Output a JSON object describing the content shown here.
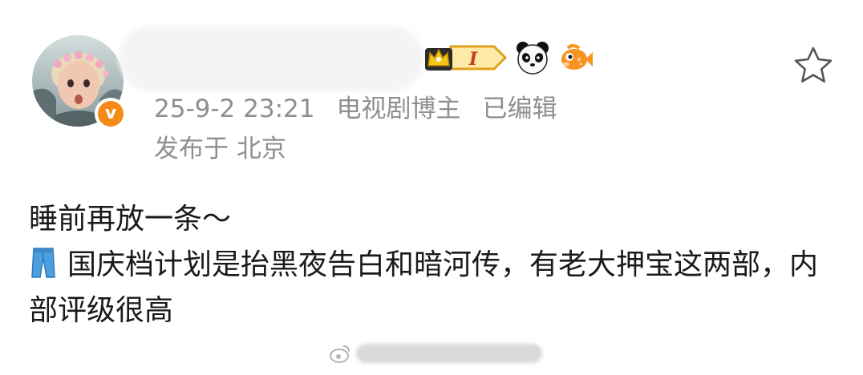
{
  "post": {
    "meta": {
      "timestamp": "25-9-2 23:21",
      "role": "电视剧博主",
      "edited": "已编辑",
      "location": "发布于 北京"
    },
    "content": {
      "line1": "睡前再放一条～",
      "line2": "国庆档计划是抬黑夜告白和暗河传，有老大押宝这两部，内部评级很高"
    },
    "badges": {
      "rank_letter": "I",
      "verified_letter": "v"
    },
    "icons": {
      "star": "star-outline-icon",
      "jeans": "jeans-emoji-icon",
      "panda": "panda-icon",
      "fish": "fish-icon",
      "crown": "crown-icon",
      "weibo": "weibo-logo-icon"
    },
    "colors": {
      "text_primary": "#1a1a1a",
      "text_secondary": "#8e8e93",
      "verified_orange": "#f48b16",
      "gold": "#f5c518",
      "jeans_blue": "#4a9fe0"
    }
  }
}
